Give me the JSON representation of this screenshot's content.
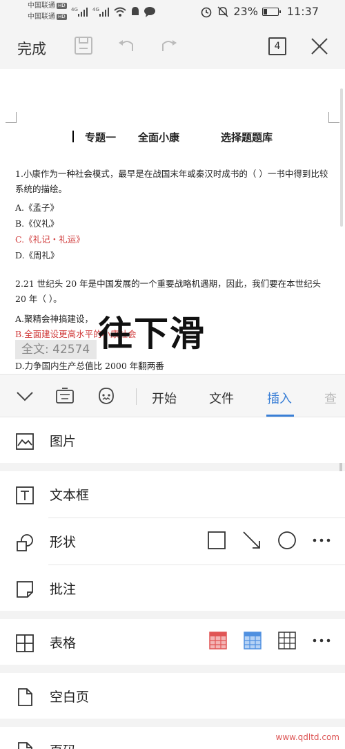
{
  "status_bar": {
    "carrier1": "中国联通",
    "carrier2": "中国联通",
    "hd": "HD",
    "battery": "23%",
    "battery_level": 0.23,
    "time": "11:37"
  },
  "toolbar": {
    "done_label": "完成",
    "page_count": "4"
  },
  "document": {
    "title_parts": [
      "专题一",
      "全面小康",
      "选择题题库"
    ],
    "q1_text": "1.小康作为一种社会模式，最早是在战国末年或秦汉时成书的（ ）一书中得到比较系统的描绘。",
    "q1_options": [
      "A.《孟子》",
      "B.《仪礼》",
      "C.《礼记・礼运》",
      "D.《周礼》"
    ],
    "q2_text": "2.21 世纪头 20 年是中国发展的一个重要战略机遇期，因此，我们要在本世纪头 20 年（ ）。",
    "q2_options": [
      "A.聚精会神搞建设，",
      "B.全面建设更高水平的小康社会",
      "D.力争国内生产总值比 2000 年翻两番"
    ],
    "overlay_text": "往下滑",
    "word_count": "全文: 42574"
  },
  "tabs": {
    "items": [
      "开始",
      "文件",
      "插入",
      "查"
    ],
    "active": "插入"
  },
  "insert_panel": {
    "picture": "图片",
    "textbox": "文本框",
    "shape": "形状",
    "comment": "批注",
    "table": "表格",
    "blank_page": "空白页",
    "page_number": "页码"
  },
  "colors": {
    "accent": "#3a7fd6",
    "answer_red": "#d03a3a",
    "table_red": "#e05555",
    "table_blue": "#4f90e0"
  },
  "watermark": "www.qdltd.com"
}
